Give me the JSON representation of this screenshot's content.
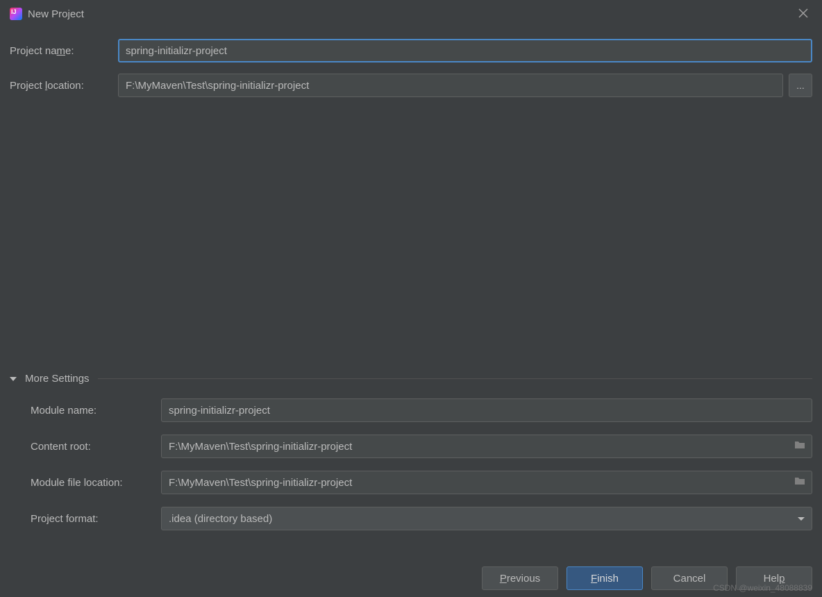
{
  "title": "New Project",
  "topForm": {
    "projectNameLabel": "Project name:",
    "projectNameValue": "spring-initializr-project",
    "projectLocationLabel": "Project location:",
    "projectLocationValue": "F:\\MyMaven\\Test\\spring-initializr-project",
    "browse": "..."
  },
  "moreSettings": {
    "header": "More Settings",
    "moduleNameLabel": "Module name:",
    "moduleNameValue": "spring-initializr-project",
    "contentRootLabel": "Content root:",
    "contentRootValue": "F:\\MyMaven\\Test\\spring-initializr-project",
    "moduleFileLocationLabel": "Module file location:",
    "moduleFileLocationValue": "F:\\MyMaven\\Test\\spring-initializr-project",
    "projectFormatLabel": "Project format:",
    "projectFormatValue": ".idea (directory based)"
  },
  "buttons": {
    "previous": "Previous",
    "finish": "Finish",
    "cancel": "Cancel",
    "help": "Help"
  },
  "watermark": "CSDN @weixin_48088839"
}
